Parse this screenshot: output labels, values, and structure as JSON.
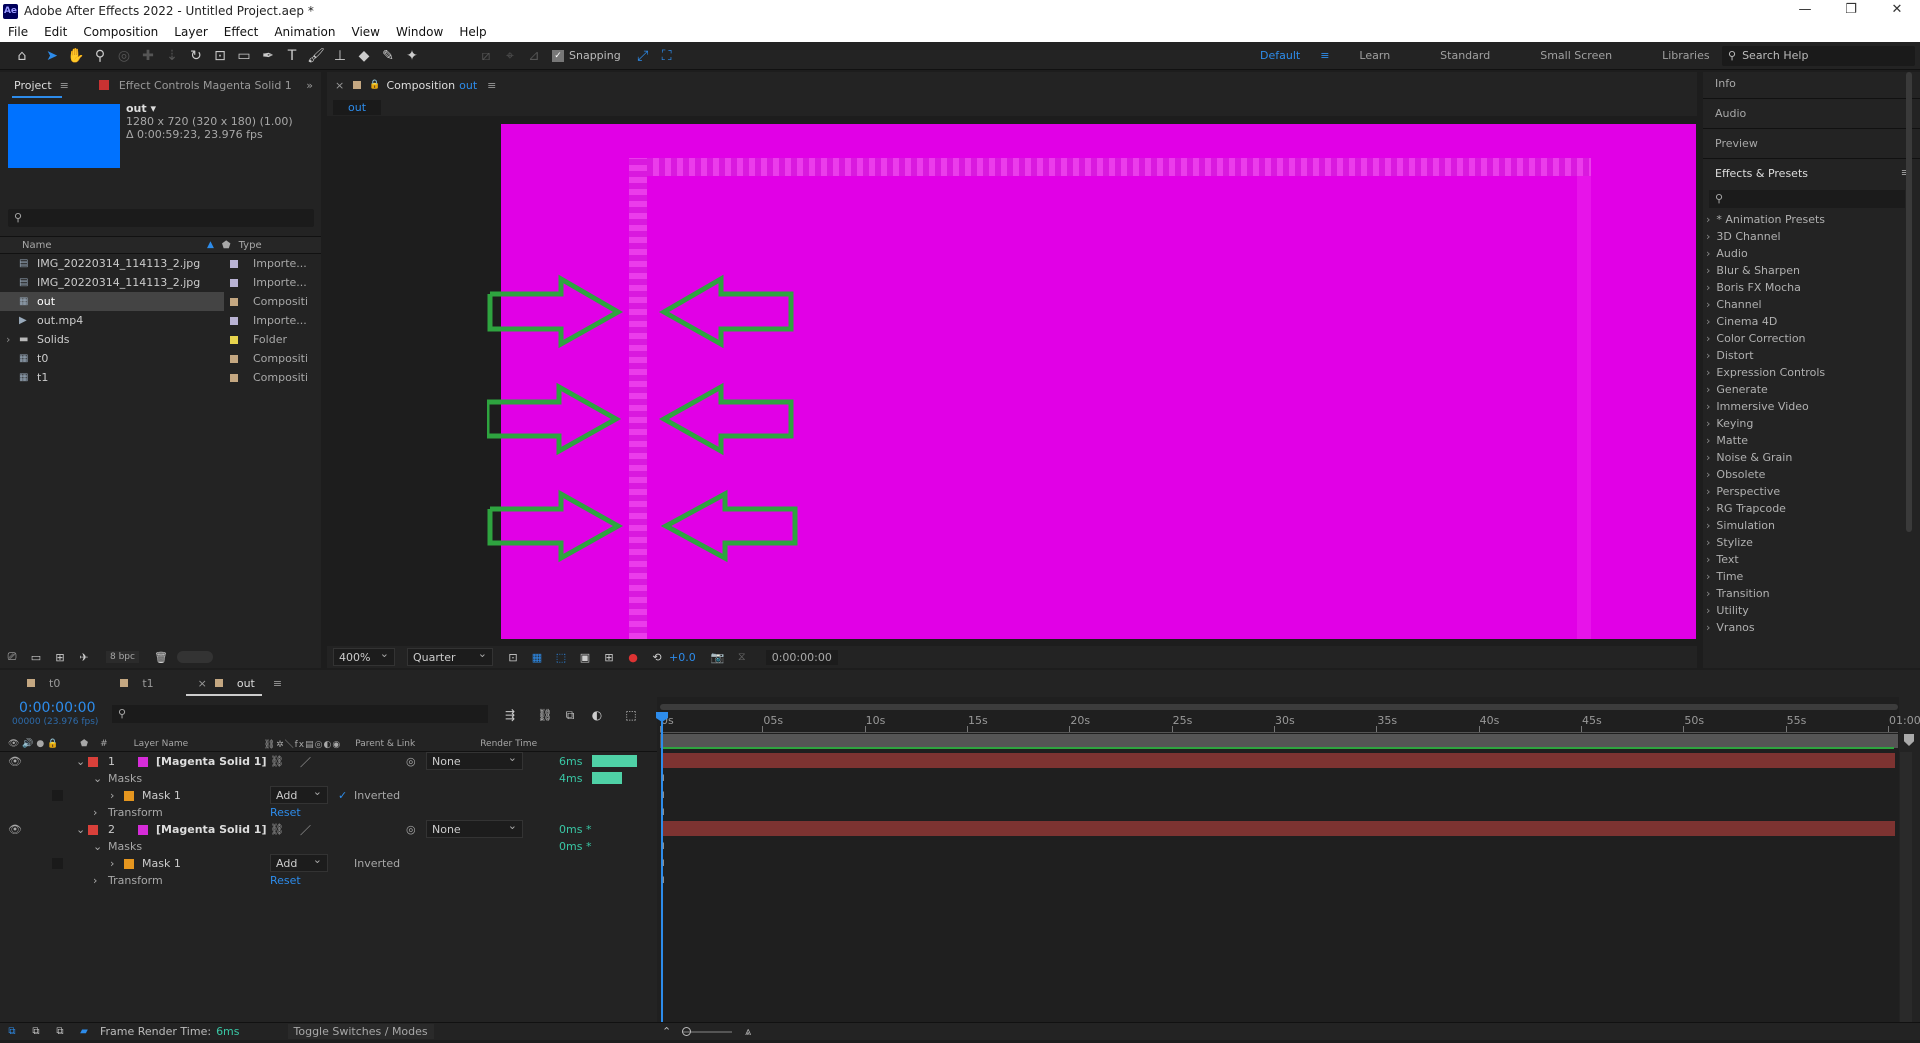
{
  "titlebar": {
    "logo": "Ae",
    "title": "Adobe After Effects 2022 - Untitled Project.aep *",
    "minimize": "—",
    "restore": "❐",
    "close": "✕"
  },
  "menu": [
    "File",
    "Edit",
    "Composition",
    "Layer",
    "Effect",
    "Animation",
    "View",
    "Window",
    "Help"
  ],
  "toolbar": {
    "snapping_label": "Snapping",
    "workspaces": [
      "Default",
      "Learn",
      "Standard",
      "Small Screen",
      "Libraries"
    ],
    "active_workspace": "Default",
    "search_help": "Search Help"
  },
  "project": {
    "tab_label": "Project",
    "effect_controls_label": "Effect Controls Magenta Solid 1",
    "selected_name": "out ▾",
    "selected_info1": "1280 x 720  (320 x 180) (1.00)",
    "selected_info2": "Δ 0:00:59:23, 23.976 fps",
    "col_name": "Name",
    "col_type": "Type",
    "items": [
      {
        "name": "IMG_20220314_114113_2.jpg",
        "type": "Importe...G",
        "label_color": "#b9b3d4",
        "icon": "image-file-icon"
      },
      {
        "name": "IMG_20220314_114113_2.jpg",
        "type": "Importe...G",
        "label_color": "#b9b3d4",
        "icon": "image-file-icon"
      },
      {
        "name": "out",
        "type": "Compositi",
        "label_color": "#c4a781",
        "icon": "composition-icon",
        "selected": true
      },
      {
        "name": "out.mp4",
        "type": "Importe...E",
        "label_color": "#b9b3d4",
        "icon": "video-file-icon"
      },
      {
        "name": "Solids",
        "type": "Folder",
        "label_color": "#e8d44d",
        "icon": "folder-icon"
      },
      {
        "name": "t0",
        "type": "Compositi",
        "label_color": "#c4a781",
        "icon": "composition-icon"
      },
      {
        "name": "t1",
        "type": "Compositi",
        "label_color": "#c4a781",
        "icon": "composition-icon"
      }
    ],
    "bpc": "8 bpc"
  },
  "composition": {
    "tab_prefix": "Composition",
    "tab_name": "out",
    "breadcrumb": "out",
    "zoom": "400%",
    "resolution": "Quarter",
    "exposure": "+0.0",
    "timecode": "0:00:00:00",
    "canvas_color": "#e100e6"
  },
  "right_panels": {
    "info": "Info",
    "audio": "Audio",
    "preview": "Preview",
    "effects_title": "Effects & Presets",
    "effects": [
      "* Animation Presets",
      "3D Channel",
      "Audio",
      "Blur & Sharpen",
      "Boris FX Mocha",
      "Channel",
      "Cinema 4D",
      "Color Correction",
      "Distort",
      "Expression Controls",
      "Generate",
      "Immersive Video",
      "Keying",
      "Matte",
      "Noise & Grain",
      "Obsolete",
      "Perspective",
      "RG Trapcode",
      "Simulation",
      "Stylize",
      "Text",
      "Time",
      "Transition",
      "Utility",
      "Vranos"
    ]
  },
  "timeline": {
    "tabs": [
      "t0",
      "t1",
      "out"
    ],
    "active_tab": "out",
    "timecode": "0:00:00:00",
    "frames": "00000 (23.976 fps)",
    "headers": {
      "num": "#",
      "layer_name": "Layer Name",
      "parent": "Parent & Link",
      "render_time": "Render Time"
    },
    "ticks": [
      "0s",
      "05s",
      "10s",
      "15s",
      "20s",
      "25s",
      "30s",
      "35s",
      "40s",
      "45s",
      "50s",
      "55s",
      "01:00"
    ],
    "layers": [
      {
        "num": "1",
        "name": "[Magenta Solid 1]",
        "parent": "None",
        "render_time": "6ms",
        "render_fraction": 0.9,
        "masks_label": "Masks",
        "masks_time": "4ms",
        "masks_fraction": 0.6,
        "mask_name": "Mask 1",
        "mask_mode": "Add",
        "inverted_label": "Inverted",
        "inverted": true,
        "transform": "Transform",
        "reset": "Reset"
      },
      {
        "num": "2",
        "name": "[Magenta Solid 1]",
        "parent": "None",
        "render_time": "0ms *",
        "masks_label": "Masks",
        "masks_time": "0ms *",
        "mask_name": "Mask 1",
        "mask_mode": "Add",
        "inverted_label": "Inverted",
        "inverted": false,
        "transform": "Transform",
        "reset": "Reset"
      }
    ]
  },
  "statusbar": {
    "frame_render_label": "Frame Render Time:",
    "frame_render_value": "6ms",
    "toggle": "Toggle Switches / Modes"
  },
  "colors": {
    "accent": "#2d8ceb",
    "layer_label": "#d9403a",
    "layer_bar": "#7d3331",
    "solid_swatch": "#d62cd9",
    "render_bar": "#4fd1a6",
    "arrow": "#2ea43f"
  }
}
